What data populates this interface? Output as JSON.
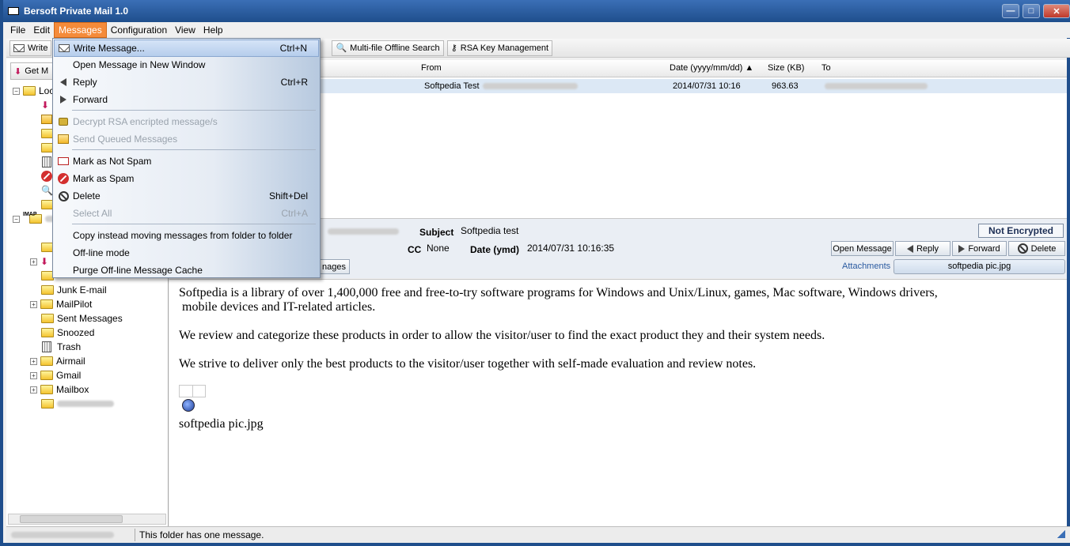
{
  "window": {
    "title": "Bersoft Private Mail 1.0"
  },
  "menubar": {
    "file": "File",
    "edit": "Edit",
    "messages": "Messages",
    "configuration": "Configuration",
    "view": "View",
    "help": "Help"
  },
  "toolbar": {
    "write": "Write",
    "offline_search": "Multi-file Offline Search",
    "rsa_key": "RSA Key Management",
    "get": "Get M"
  },
  "tree": {
    "local_partial": "Loc",
    "imap_badge": "IMAP",
    "folders": [
      {
        "label": "Junk E-mail",
        "expandable": false
      },
      {
        "label": "MailPilot",
        "expandable": true
      },
      {
        "label": "Sent Messages",
        "expandable": false
      },
      {
        "label": "Snoozed",
        "expandable": false
      },
      {
        "label": "Trash",
        "expandable": false
      },
      {
        "label": "Airmail",
        "expandable": true
      },
      {
        "label": "Gmail",
        "expandable": true
      },
      {
        "label": "Mailbox",
        "expandable": true
      }
    ]
  },
  "message_list": {
    "columns": {
      "from": "From",
      "date": "Date (yyyy/mm/dd)",
      "size": "Size (KB)",
      "to": "To"
    },
    "rows": [
      {
        "from": "Softpedia Test",
        "date": "2014/07/31 10:16",
        "size": "963.63"
      }
    ]
  },
  "message_header": {
    "subject_label": "Subject",
    "subject": "Softpedia test",
    "cc_label": "CC",
    "cc": "None",
    "date_label": "Date (ymd)",
    "date": "2014/07/31 10:16:35",
    "encryption_status": "Not Encrypted",
    "open_message": "Open Message",
    "reply": "Reply",
    "forward": "Forward",
    "delete": "Delete",
    "attachments_label": "Attachments",
    "attachment_name": "softpedia pic.jpg",
    "manage_partial": "nages"
  },
  "message_body": {
    "p1_line1": "Softpedia is a library of over 1,400,000 free and free-to-try software  programs for Windows and Unix/Linux, games, Mac software, Windows drivers,",
    "p1_line2": " mobile devices and IT-related articles.",
    "p2": "We review and categorize these products in order to allow the visitor/user  to find the exact product they and their system needs.",
    "p3": "We strive to deliver only the best products to the visitor/user together with self-made evaluation and review notes.",
    "attachment_caption": "softpedia pic.jpg"
  },
  "status": {
    "text": "This folder has one message."
  },
  "dropdown": {
    "write_message": "Write Message...",
    "write_message_sc": "Ctrl+N",
    "open_new_window": "Open Message in New Window",
    "reply": "Reply",
    "reply_sc": "Ctrl+R",
    "forward": "Forward",
    "decrypt": "Decrypt RSA encripted message/s",
    "send_queued": "Send Queued Messages",
    "not_spam": "Mark as Not Spam",
    "spam": "Mark as Spam",
    "delete": "Delete",
    "delete_sc": "Shift+Del",
    "select_all": "Select All",
    "select_all_sc": "Ctrl+A",
    "copy_instead": "Copy instead moving messages from folder to folder",
    "offline_mode": "Off-line mode",
    "purge_cache": "Purge Off-line Message Cache"
  }
}
